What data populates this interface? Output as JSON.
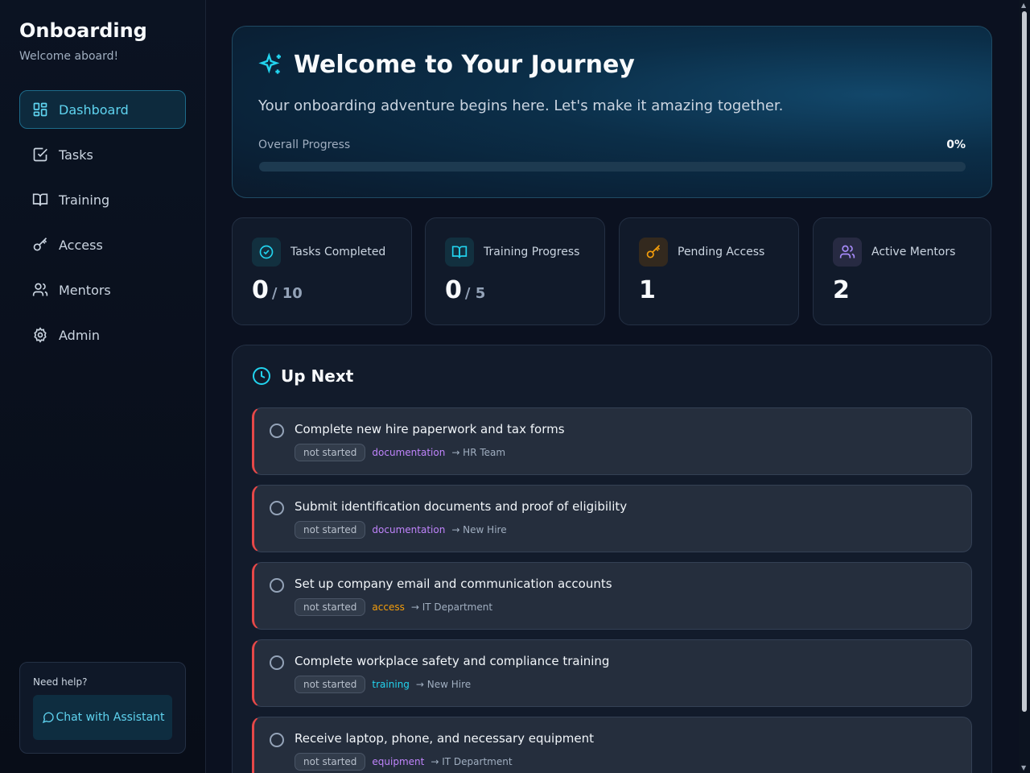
{
  "sidebar": {
    "title": "Onboarding",
    "subtitle": "Welcome aboard!",
    "items": [
      {
        "label": "Dashboard",
        "icon": "dashboard-icon",
        "active": true
      },
      {
        "label": "Tasks",
        "icon": "checkbox-icon"
      },
      {
        "label": "Training",
        "icon": "book-icon"
      },
      {
        "label": "Access",
        "icon": "key-icon"
      },
      {
        "label": "Mentors",
        "icon": "users-icon"
      },
      {
        "label": "Admin",
        "icon": "gear-icon"
      }
    ],
    "help": {
      "label": "Need help?",
      "button": "Chat with Assistant"
    }
  },
  "hero": {
    "title": "Welcome to Your Journey",
    "subtitle": "Your onboarding adventure begins here. Let's make it amazing together.",
    "progress_label": "Overall Progress",
    "progress_text": "0%",
    "progress_value": 0
  },
  "stats": [
    {
      "label": "Tasks Completed",
      "value": "0",
      "total": "/ 10",
      "icon": "check-circle-icon",
      "color": "#22d3ee"
    },
    {
      "label": "Training Progress",
      "value": "0",
      "total": "/ 5",
      "icon": "book-icon",
      "color": "#22d3ee"
    },
    {
      "label": "Pending Access",
      "value": "1",
      "total": "",
      "icon": "key-icon",
      "color": "#f59e0b"
    },
    {
      "label": "Active Mentors",
      "value": "2",
      "total": "",
      "icon": "users-icon",
      "color": "#a78bfa"
    }
  ],
  "up_next": {
    "title": "Up Next",
    "tasks": [
      {
        "title": "Complete new hire paperwork and tax forms",
        "status": "not started",
        "category": "documentation",
        "category_color": "#c084fc",
        "owner": "→ HR Team"
      },
      {
        "title": "Submit identification documents and proof of eligibility",
        "status": "not started",
        "category": "documentation",
        "category_color": "#c084fc",
        "owner": "→ New Hire"
      },
      {
        "title": "Set up company email and communication accounts",
        "status": "not started",
        "category": "access",
        "category_color": "#f59e0b",
        "owner": "→ IT Department"
      },
      {
        "title": "Complete workplace safety and compliance training",
        "status": "not started",
        "category": "training",
        "category_color": "#22d3ee",
        "owner": "→ New Hire"
      },
      {
        "title": "Receive laptop, phone, and necessary equipment",
        "status": "not started",
        "category": "equipment",
        "category_color": "#c084fc",
        "owner": "→ IT Department"
      }
    ]
  },
  "colors": {
    "accent": "#22d3ee",
    "danger": "#e64848"
  }
}
